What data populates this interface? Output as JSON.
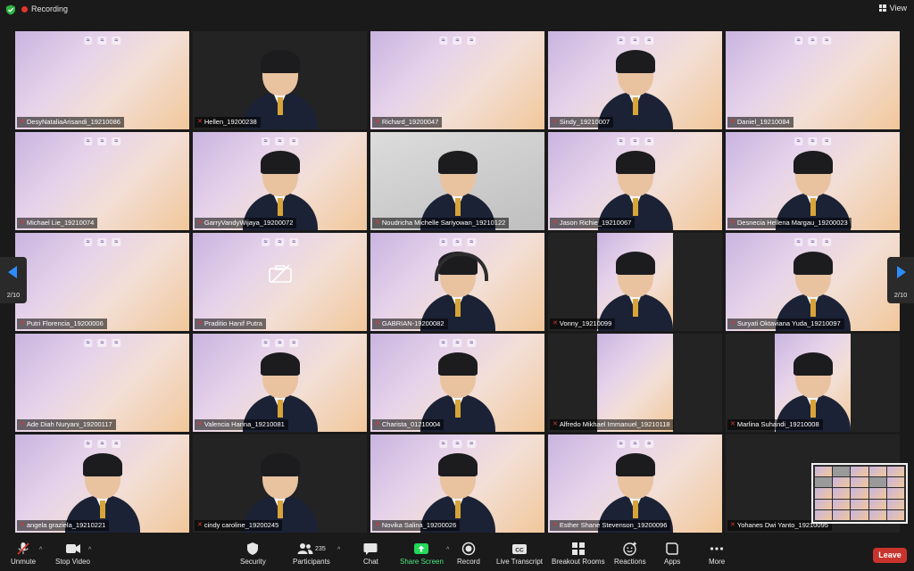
{
  "topbar": {
    "recording": "Recording",
    "view": "View"
  },
  "pagination": {
    "left": "2/10",
    "right": "2/10"
  },
  "participants": [
    {
      "name": "DesyNataliaArisandi_19210086",
      "muted": true,
      "bg": "brand",
      "person": false
    },
    {
      "name": "Hellen_19200238",
      "muted": true,
      "bg": "dark",
      "person": true
    },
    {
      "name": "Richard_19200047",
      "muted": true,
      "bg": "brand",
      "person": false
    },
    {
      "name": "Sindy_19210007",
      "muted": true,
      "bg": "brand",
      "person": true
    },
    {
      "name": "Daniel_19210084",
      "muted": true,
      "bg": "brand",
      "person": false
    },
    {
      "name": "Michael Lie_19210074",
      "muted": true,
      "bg": "brand",
      "person": false
    },
    {
      "name": "GarryVandyWijaya_19200072",
      "muted": true,
      "bg": "brand",
      "person": true
    },
    {
      "name": "Noudricha Michelle Sariyowan_19210122",
      "muted": true,
      "bg": "room",
      "person": true
    },
    {
      "name": "Jason Richie_19210067",
      "muted": true,
      "bg": "brand",
      "person": true
    },
    {
      "name": "Desnecia Hellena Margau_19200023",
      "muted": true,
      "bg": "brand",
      "person": true
    },
    {
      "name": "Putri Florencia_19200006",
      "muted": true,
      "bg": "brand",
      "person": false
    },
    {
      "name": "Praditio Hanif Putra",
      "muted": true,
      "bg": "brand",
      "person": false,
      "video_off": true
    },
    {
      "name": "GABRIAN-19200082",
      "muted": true,
      "bg": "brand",
      "person": true,
      "headset": true
    },
    {
      "name": "Vonny_19210099",
      "muted": true,
      "bg": "dark-panel",
      "person": true
    },
    {
      "name": "Suryati Oktaviana Yuda_19210097",
      "muted": true,
      "bg": "brand",
      "person": true
    },
    {
      "name": "Ade Diah Nuryani_19200117",
      "muted": true,
      "bg": "brand",
      "person": false
    },
    {
      "name": "Valencia Hanna_19210081",
      "muted": true,
      "bg": "brand",
      "person": true
    },
    {
      "name": "Charista_01210004",
      "muted": true,
      "bg": "brand",
      "person": true
    },
    {
      "name": "Alfredo Mikhael Immanuel_19210118",
      "muted": true,
      "bg": "dark-panel",
      "person": false
    },
    {
      "name": "Marlina Suhandi_19210008",
      "muted": true,
      "bg": "dark-panel",
      "person": true
    },
    {
      "name": "angela graziela_19210221",
      "muted": true,
      "bg": "brand",
      "person": true
    },
    {
      "name": "cindy caroline_19200245",
      "muted": true,
      "bg": "dark",
      "person": true
    },
    {
      "name": "Novika Salina_19200026",
      "muted": true,
      "bg": "brand",
      "person": true
    },
    {
      "name": "Esther Shane Stevenson_19200096",
      "muted": true,
      "bg": "brand",
      "person": true
    },
    {
      "name": "Yohanes Dwi Yanto_19210095",
      "muted": true,
      "bg": "dark",
      "person": false
    }
  ],
  "toolbar": {
    "unmute": "Unmute",
    "stop_video": "Stop Video",
    "security": "Security",
    "participants": "Participants",
    "participant_count": "235",
    "chat": "Chat",
    "share_screen": "Share Screen",
    "record": "Record",
    "live_transcript": "Live Transcript",
    "breakout_rooms": "Breakout Rooms",
    "reactions": "Reactions",
    "apps": "Apps",
    "more": "More",
    "leave": "Leave"
  },
  "colors": {
    "accent": "#2d8cff",
    "leave": "#c8342d",
    "share": "#23d959",
    "recording": "#e0362c"
  },
  "icons": [
    "shield-icon",
    "record-dot-icon",
    "view-grid-icon",
    "mic-off-icon",
    "video-icon",
    "security-icon",
    "participants-icon",
    "chat-icon",
    "share-screen-icon",
    "record-icon",
    "cc-icon",
    "breakout-rooms-icon",
    "reactions-icon",
    "apps-icon",
    "more-icon",
    "camera-off-icon",
    "chevron-left-icon",
    "chevron-right-icon"
  ]
}
